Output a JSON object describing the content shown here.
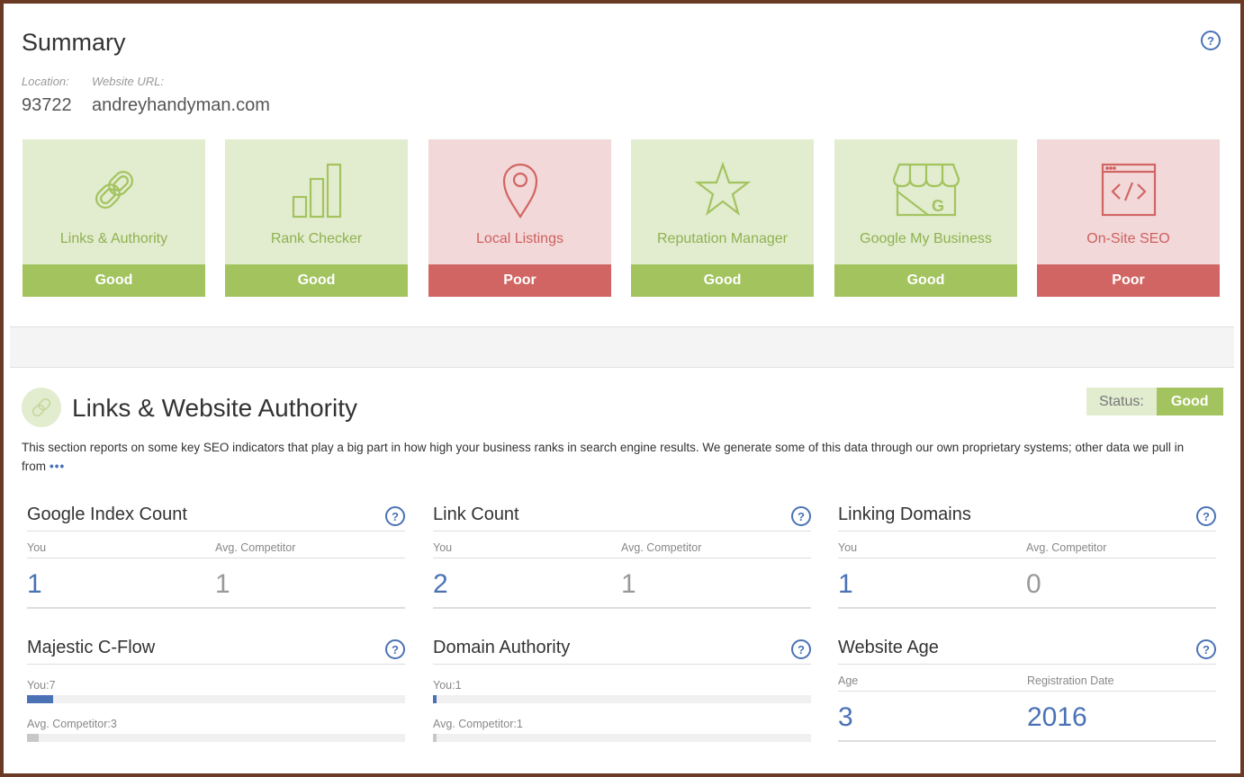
{
  "summary": {
    "title": "Summary",
    "location_label": "Location:",
    "location": "93722",
    "url_label": "Website URL:",
    "url": "andreyhandyman.com"
  },
  "cards": [
    {
      "label": "Links & Authority",
      "status": "Good",
      "icon": "links-icon"
    },
    {
      "label": "Rank Checker",
      "status": "Good",
      "icon": "bar-chart-icon"
    },
    {
      "label": "Local Listings",
      "status": "Poor",
      "icon": "map-pin-icon"
    },
    {
      "label": "Reputation Manager",
      "status": "Good",
      "icon": "star-icon"
    },
    {
      "label": "Google My Business",
      "status": "Good",
      "icon": "storefront-icon"
    },
    {
      "label": "On-Site SEO",
      "status": "Poor",
      "icon": "code-window-icon"
    }
  ],
  "colors": {
    "good_bg": "#e2eccf",
    "good": "#a3c35f",
    "poor_bg": "#f2d8d8",
    "poor": "#d16563",
    "accent": "#4a72b5"
  },
  "section": {
    "title": "Links & Website Authority",
    "status_label": "Status:",
    "status": "Good",
    "description": "This section reports on some key SEO indicators that play a big part in how high your business ranks in search engine results. We generate some of this data through our own proprietary systems; other data we pull in from",
    "more": "•••"
  },
  "metrics": {
    "google_index": {
      "title": "Google Index Count",
      "you_label": "You",
      "comp_label": "Avg. Competitor",
      "you": "1",
      "comp": "1"
    },
    "link_count": {
      "title": "Link Count",
      "you_label": "You",
      "comp_label": "Avg. Competitor",
      "you": "2",
      "comp": "1"
    },
    "linking_domains": {
      "title": "Linking Domains",
      "you_label": "You",
      "comp_label": "Avg. Competitor",
      "you": "1",
      "comp": "0"
    },
    "majestic": {
      "title": "Majestic C-Flow",
      "you_label": "You:7",
      "comp_label": "Avg. Competitor:3",
      "you_value": 7,
      "comp_value": 3,
      "max": 100
    },
    "domain_authority": {
      "title": "Domain Authority",
      "you_label": "You:1",
      "comp_label": "Avg. Competitor:1",
      "you_value": 1,
      "comp_value": 1,
      "max": 100
    },
    "website_age": {
      "title": "Website Age",
      "age_label": "Age",
      "reg_label": "Registration Date",
      "age": "3",
      "reg": "2016"
    }
  }
}
